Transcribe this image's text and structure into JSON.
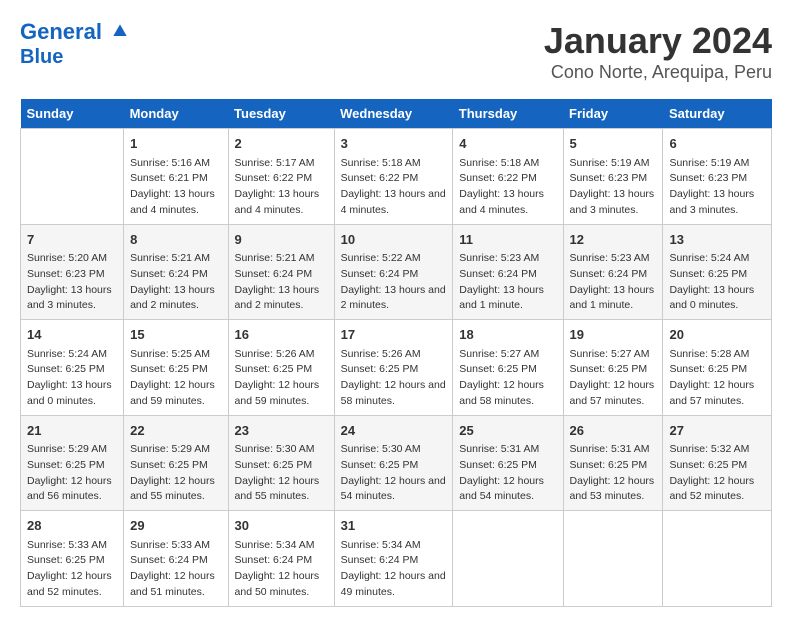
{
  "logo": {
    "line1": "General",
    "line2": "Blue"
  },
  "title": "January 2024",
  "subtitle": "Cono Norte, Arequipa, Peru",
  "headers": [
    "Sunday",
    "Monday",
    "Tuesday",
    "Wednesday",
    "Thursday",
    "Friday",
    "Saturday"
  ],
  "weeks": [
    [
      {
        "day": "",
        "sunrise": "",
        "sunset": "",
        "daylight": ""
      },
      {
        "day": "1",
        "sunrise": "Sunrise: 5:16 AM",
        "sunset": "Sunset: 6:21 PM",
        "daylight": "Daylight: 13 hours and 4 minutes."
      },
      {
        "day": "2",
        "sunrise": "Sunrise: 5:17 AM",
        "sunset": "Sunset: 6:22 PM",
        "daylight": "Daylight: 13 hours and 4 minutes."
      },
      {
        "day": "3",
        "sunrise": "Sunrise: 5:18 AM",
        "sunset": "Sunset: 6:22 PM",
        "daylight": "Daylight: 13 hours and 4 minutes."
      },
      {
        "day": "4",
        "sunrise": "Sunrise: 5:18 AM",
        "sunset": "Sunset: 6:22 PM",
        "daylight": "Daylight: 13 hours and 4 minutes."
      },
      {
        "day": "5",
        "sunrise": "Sunrise: 5:19 AM",
        "sunset": "Sunset: 6:23 PM",
        "daylight": "Daylight: 13 hours and 3 minutes."
      },
      {
        "day": "6",
        "sunrise": "Sunrise: 5:19 AM",
        "sunset": "Sunset: 6:23 PM",
        "daylight": "Daylight: 13 hours and 3 minutes."
      }
    ],
    [
      {
        "day": "7",
        "sunrise": "Sunrise: 5:20 AM",
        "sunset": "Sunset: 6:23 PM",
        "daylight": "Daylight: 13 hours and 3 minutes."
      },
      {
        "day": "8",
        "sunrise": "Sunrise: 5:21 AM",
        "sunset": "Sunset: 6:24 PM",
        "daylight": "Daylight: 13 hours and 2 minutes."
      },
      {
        "day": "9",
        "sunrise": "Sunrise: 5:21 AM",
        "sunset": "Sunset: 6:24 PM",
        "daylight": "Daylight: 13 hours and 2 minutes."
      },
      {
        "day": "10",
        "sunrise": "Sunrise: 5:22 AM",
        "sunset": "Sunset: 6:24 PM",
        "daylight": "Daylight: 13 hours and 2 minutes."
      },
      {
        "day": "11",
        "sunrise": "Sunrise: 5:23 AM",
        "sunset": "Sunset: 6:24 PM",
        "daylight": "Daylight: 13 hours and 1 minute."
      },
      {
        "day": "12",
        "sunrise": "Sunrise: 5:23 AM",
        "sunset": "Sunset: 6:24 PM",
        "daylight": "Daylight: 13 hours and 1 minute."
      },
      {
        "day": "13",
        "sunrise": "Sunrise: 5:24 AM",
        "sunset": "Sunset: 6:25 PM",
        "daylight": "Daylight: 13 hours and 0 minutes."
      }
    ],
    [
      {
        "day": "14",
        "sunrise": "Sunrise: 5:24 AM",
        "sunset": "Sunset: 6:25 PM",
        "daylight": "Daylight: 13 hours and 0 minutes."
      },
      {
        "day": "15",
        "sunrise": "Sunrise: 5:25 AM",
        "sunset": "Sunset: 6:25 PM",
        "daylight": "Daylight: 12 hours and 59 minutes."
      },
      {
        "day": "16",
        "sunrise": "Sunrise: 5:26 AM",
        "sunset": "Sunset: 6:25 PM",
        "daylight": "Daylight: 12 hours and 59 minutes."
      },
      {
        "day": "17",
        "sunrise": "Sunrise: 5:26 AM",
        "sunset": "Sunset: 6:25 PM",
        "daylight": "Daylight: 12 hours and 58 minutes."
      },
      {
        "day": "18",
        "sunrise": "Sunrise: 5:27 AM",
        "sunset": "Sunset: 6:25 PM",
        "daylight": "Daylight: 12 hours and 58 minutes."
      },
      {
        "day": "19",
        "sunrise": "Sunrise: 5:27 AM",
        "sunset": "Sunset: 6:25 PM",
        "daylight": "Daylight: 12 hours and 57 minutes."
      },
      {
        "day": "20",
        "sunrise": "Sunrise: 5:28 AM",
        "sunset": "Sunset: 6:25 PM",
        "daylight": "Daylight: 12 hours and 57 minutes."
      }
    ],
    [
      {
        "day": "21",
        "sunrise": "Sunrise: 5:29 AM",
        "sunset": "Sunset: 6:25 PM",
        "daylight": "Daylight: 12 hours and 56 minutes."
      },
      {
        "day": "22",
        "sunrise": "Sunrise: 5:29 AM",
        "sunset": "Sunset: 6:25 PM",
        "daylight": "Daylight: 12 hours and 55 minutes."
      },
      {
        "day": "23",
        "sunrise": "Sunrise: 5:30 AM",
        "sunset": "Sunset: 6:25 PM",
        "daylight": "Daylight: 12 hours and 55 minutes."
      },
      {
        "day": "24",
        "sunrise": "Sunrise: 5:30 AM",
        "sunset": "Sunset: 6:25 PM",
        "daylight": "Daylight: 12 hours and 54 minutes."
      },
      {
        "day": "25",
        "sunrise": "Sunrise: 5:31 AM",
        "sunset": "Sunset: 6:25 PM",
        "daylight": "Daylight: 12 hours and 54 minutes."
      },
      {
        "day": "26",
        "sunrise": "Sunrise: 5:31 AM",
        "sunset": "Sunset: 6:25 PM",
        "daylight": "Daylight: 12 hours and 53 minutes."
      },
      {
        "day": "27",
        "sunrise": "Sunrise: 5:32 AM",
        "sunset": "Sunset: 6:25 PM",
        "daylight": "Daylight: 12 hours and 52 minutes."
      }
    ],
    [
      {
        "day": "28",
        "sunrise": "Sunrise: 5:33 AM",
        "sunset": "Sunset: 6:25 PM",
        "daylight": "Daylight: 12 hours and 52 minutes."
      },
      {
        "day": "29",
        "sunrise": "Sunrise: 5:33 AM",
        "sunset": "Sunset: 6:24 PM",
        "daylight": "Daylight: 12 hours and 51 minutes."
      },
      {
        "day": "30",
        "sunrise": "Sunrise: 5:34 AM",
        "sunset": "Sunset: 6:24 PM",
        "daylight": "Daylight: 12 hours and 50 minutes."
      },
      {
        "day": "31",
        "sunrise": "Sunrise: 5:34 AM",
        "sunset": "Sunset: 6:24 PM",
        "daylight": "Daylight: 12 hours and 49 minutes."
      },
      {
        "day": "",
        "sunrise": "",
        "sunset": "",
        "daylight": ""
      },
      {
        "day": "",
        "sunrise": "",
        "sunset": "",
        "daylight": ""
      },
      {
        "day": "",
        "sunrise": "",
        "sunset": "",
        "daylight": ""
      }
    ]
  ]
}
